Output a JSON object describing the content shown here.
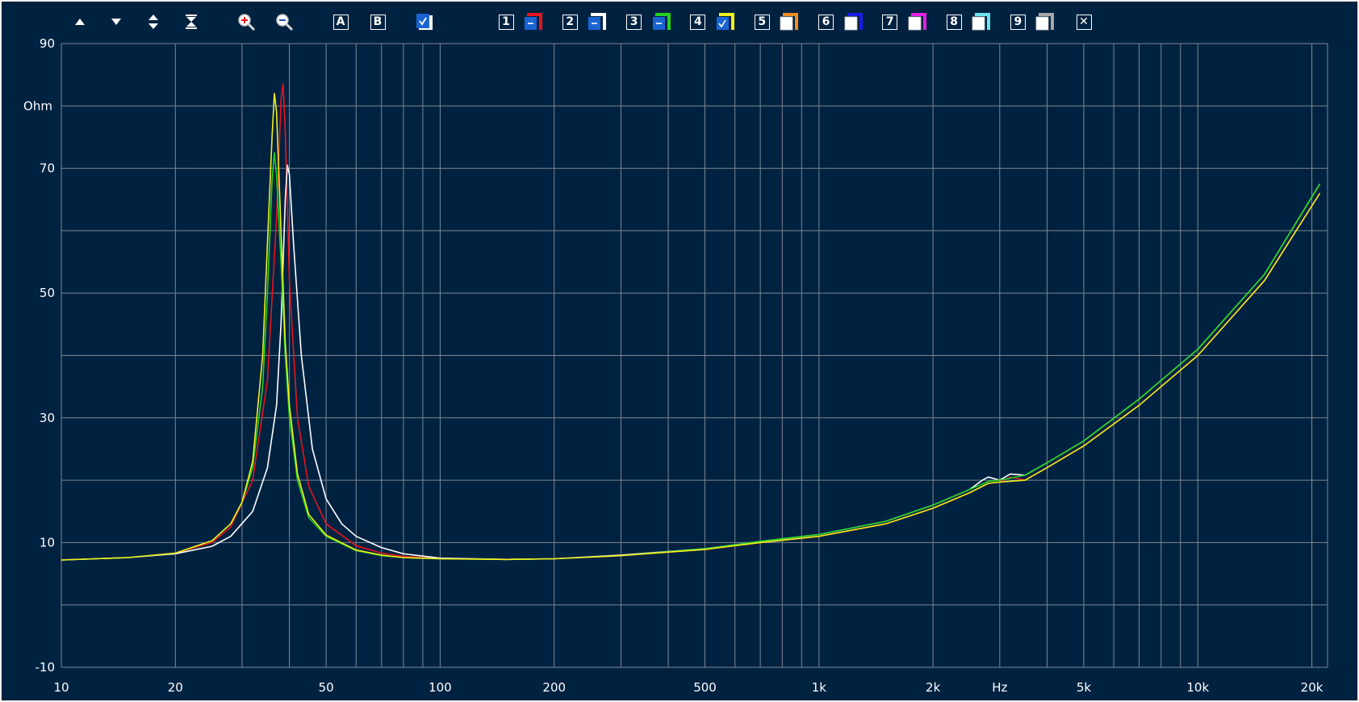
{
  "toolbar": {
    "icons": [
      {
        "name": "arrow-up-icon"
      },
      {
        "name": "arrow-down-icon"
      },
      {
        "name": "expand-vertical-icon"
      },
      {
        "name": "collapse-vertical-icon"
      },
      {
        "name": "zoom-in-icon"
      },
      {
        "name": "zoom-out-icon"
      }
    ],
    "cursor_a": "A",
    "cursor_b": "B",
    "channels": [
      {
        "num": "1",
        "color": "#e8141e",
        "state": "minus"
      },
      {
        "num": "2",
        "color": "#ffffff",
        "state": "minus"
      },
      {
        "num": "3",
        "color": "#22d21e",
        "state": "minus"
      },
      {
        "num": "4",
        "color": "#f2ef1c",
        "state": "check"
      },
      {
        "num": "5",
        "color": "#f08c1e",
        "state": "empty"
      },
      {
        "num": "6",
        "color": "#1a1ae8",
        "state": "empty"
      },
      {
        "num": "7",
        "color": "#e61ee6",
        "state": "empty"
      },
      {
        "num": "8",
        "color": "#6ce6ee",
        "state": "empty"
      },
      {
        "num": "9",
        "color": "#a8a8a8",
        "state": "empty"
      }
    ],
    "close_label": "✕"
  },
  "colors": {
    "background": "#002241",
    "grid": "#7d8792",
    "text": "#ffffff",
    "unit_label": "#f2eea8"
  },
  "chart_data": {
    "type": "line",
    "xscale": "log",
    "xlim": [
      10,
      22000
    ],
    "ylim": [
      -10,
      90
    ],
    "xlabel": "Hz",
    "ylabel": "Ohm",
    "grid": true,
    "yticks": [
      {
        "value": -10,
        "label": "-10"
      },
      {
        "value": 10,
        "label": "10"
      },
      {
        "value": 30,
        "label": "30"
      },
      {
        "value": 50,
        "label": "50"
      },
      {
        "value": 70,
        "label": "70"
      },
      {
        "value": 90,
        "label": "90"
      }
    ],
    "xticks": [
      {
        "value": 10,
        "label": "10"
      },
      {
        "value": 20,
        "label": "20"
      },
      {
        "value": 50,
        "label": "50"
      },
      {
        "value": 100,
        "label": "100"
      },
      {
        "value": 200,
        "label": "200"
      },
      {
        "value": 500,
        "label": "500"
      },
      {
        "value": 1000,
        "label": "1k"
      },
      {
        "value": 2000,
        "label": "2k"
      },
      {
        "value": 5000,
        "label": "5k"
      },
      {
        "value": 10000,
        "label": "10k"
      },
      {
        "value": 20000,
        "label": "20k"
      }
    ],
    "series": [
      {
        "color": "#e8141e",
        "x": [
          10,
          15,
          20,
          25,
          28,
          32,
          35,
          37,
          38,
          38.5,
          39,
          40,
          42,
          45,
          50,
          60,
          70,
          80,
          100,
          150,
          200,
          300,
          500,
          700,
          1000,
          1500,
          2000,
          2500,
          2800,
          3000,
          3200,
          3500,
          4000,
          5000,
          7000,
          10000,
          15000,
          21000
        ],
        "y": [
          7.2,
          7.6,
          8.3,
          10,
          12.5,
          20,
          36,
          62,
          81,
          83.5,
          76,
          52,
          30,
          19,
          13,
          9.5,
          8.3,
          7.8,
          7.4,
          7.3,
          7.4,
          7.9,
          8.9,
          10,
          11,
          13,
          15.5,
          18,
          19.5,
          19.7,
          20.5,
          20,
          22,
          25.5,
          32,
          40,
          52,
          66
        ]
      },
      {
        "color": "#ffffff",
        "x": [
          10,
          15,
          20,
          25,
          28,
          32,
          35,
          37,
          38,
          39,
          39.5,
          40,
          41,
          43,
          46,
          50,
          55,
          60,
          70,
          80,
          100,
          150,
          200,
          300,
          500,
          700,
          1000,
          1500,
          2000,
          2500,
          2700,
          2800,
          3000,
          3200,
          3500,
          4000,
          5000,
          7000,
          10000,
          15000,
          21000
        ],
        "y": [
          7.2,
          7.6,
          8.2,
          9.4,
          11,
          15,
          22,
          32,
          45,
          65,
          70.5,
          69,
          58,
          40,
          25,
          17,
          13,
          11,
          9.2,
          8.2,
          7.5,
          7.3,
          7.4,
          8,
          9,
          10.2,
          11.3,
          13.4,
          16,
          18.5,
          20,
          20.5,
          20,
          21,
          20.8,
          22.8,
          26.3,
          33,
          41,
          53,
          67.5
        ]
      },
      {
        "color": "#22d21e",
        "x": [
          10,
          15,
          20,
          25,
          28,
          30,
          32,
          34,
          35,
          36,
          36.5,
          37,
          38,
          39,
          40,
          42,
          45,
          50,
          60,
          70,
          80,
          100,
          150,
          200,
          300,
          500,
          700,
          1000,
          1500,
          2000,
          2500,
          2800,
          3000,
          3500,
          4000,
          5000,
          7000,
          10000,
          15000,
          21000
        ],
        "y": [
          7.2,
          7.6,
          8.3,
          10.3,
          13,
          16.5,
          22,
          35,
          50,
          68,
          72.5,
          69,
          55,
          40,
          30,
          20,
          14,
          11,
          8.7,
          7.9,
          7.6,
          7.4,
          7.3,
          7.4,
          7.9,
          9,
          10.2,
          11.3,
          13.4,
          16,
          18.5,
          19.8,
          20,
          20.8,
          22.8,
          26.3,
          33,
          41,
          53,
          67.5
        ]
      },
      {
        "color": "#f2ef1c",
        "x": [
          10,
          15,
          20,
          25,
          28,
          30,
          32,
          34,
          35,
          36,
          36.5,
          37,
          38,
          39,
          40,
          42,
          45,
          50,
          60,
          70,
          80,
          100,
          150,
          200,
          300,
          500,
          700,
          1000,
          1500,
          2000,
          2500,
          2800,
          3000,
          3500,
          4000,
          5000,
          7000,
          10000,
          15000,
          21000
        ],
        "y": [
          7.2,
          7.6,
          8.3,
          10.3,
          13,
          16.5,
          23,
          40,
          58,
          75,
          82,
          79,
          60,
          42,
          32,
          21,
          14.5,
          11.2,
          8.8,
          8,
          7.6,
          7.4,
          7.3,
          7.4,
          7.9,
          8.9,
          10,
          11,
          13,
          15.5,
          18,
          19.5,
          19.7,
          20,
          22,
          25.5,
          32,
          40,
          52,
          66
        ]
      }
    ]
  }
}
